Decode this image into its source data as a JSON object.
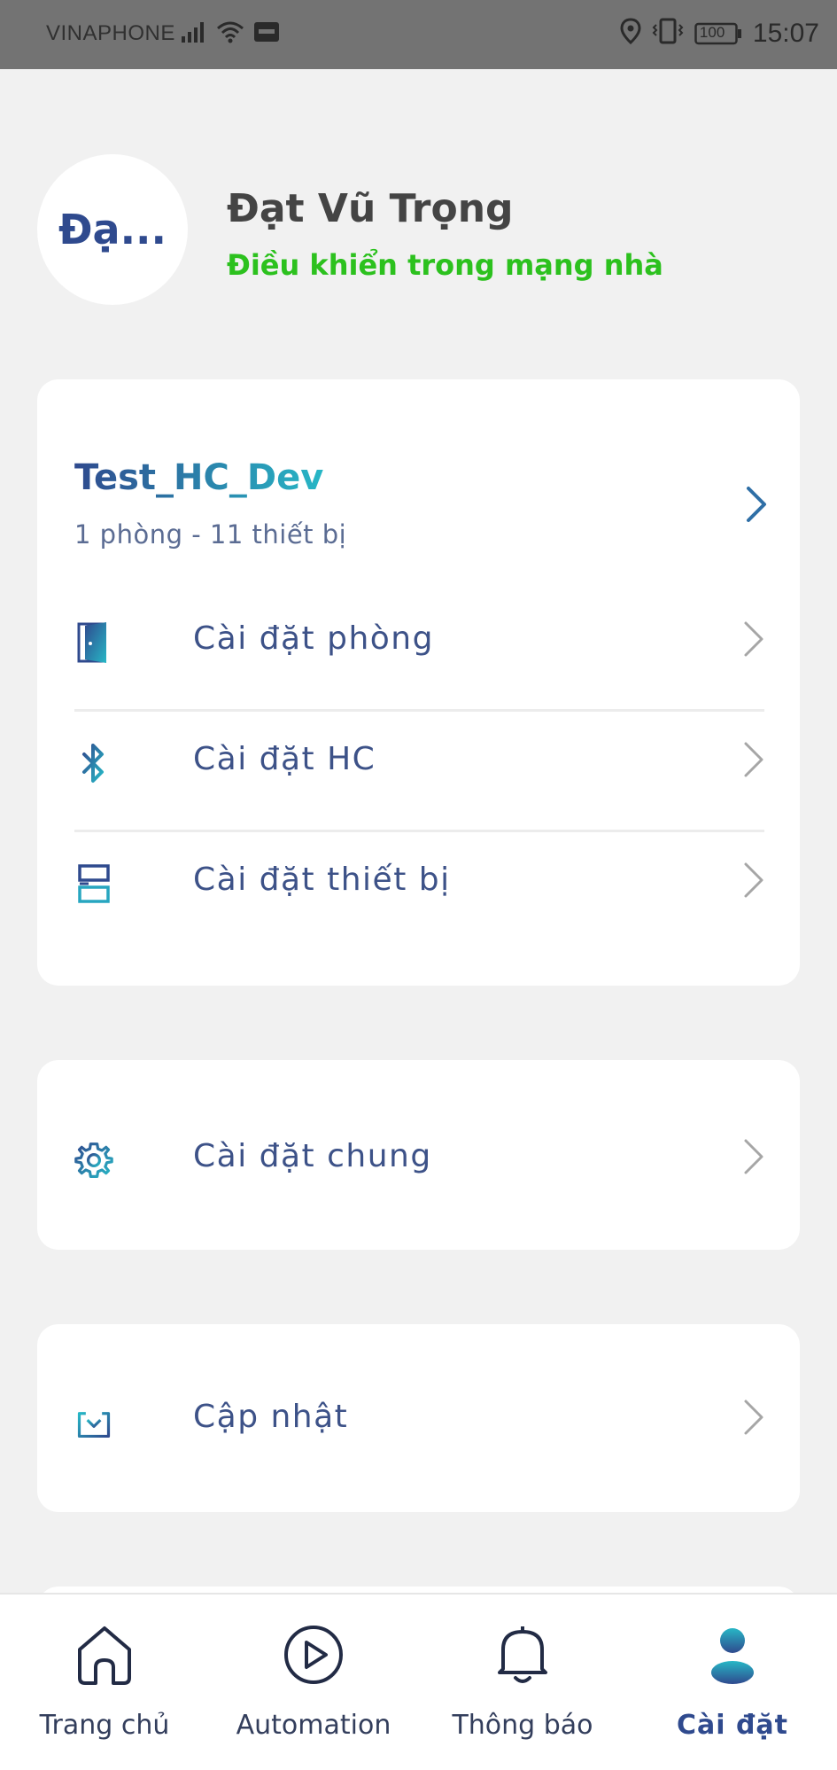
{
  "status_bar": {
    "carrier": "VINAPHONE",
    "battery": "100",
    "time": "15:07"
  },
  "profile": {
    "avatar_text": "Đạ...",
    "name": "Đạt Vũ Trọng",
    "mode": "Điều khiển trong mạng nhà"
  },
  "home": {
    "name": "Test_HC_Dev",
    "summary": "1 phòng - 11 thiết bị",
    "items": [
      {
        "label": "Cài đặt phòng",
        "icon": "door-icon"
      },
      {
        "label": "Cài đặt HC",
        "icon": "bluetooth-icon"
      },
      {
        "label": "Cài đặt thiết bị",
        "icon": "device-icon"
      }
    ]
  },
  "general": {
    "label": "Cài đặt chung",
    "icon": "gear-icon"
  },
  "update": {
    "label": "Cập nhật",
    "icon": "download-icon"
  },
  "nav": [
    {
      "label": "Trang chủ",
      "icon": "home-icon",
      "active": false
    },
    {
      "label": "Automation",
      "icon": "play-icon",
      "active": false
    },
    {
      "label": "Thông báo",
      "icon": "bell-icon",
      "active": false
    },
    {
      "label": "Cài đặt",
      "icon": "user-icon",
      "active": true
    }
  ],
  "colors": {
    "accent_dark": "#2f4a8e",
    "accent_teal": "#27b7c6",
    "status_green": "#2cc11e",
    "background": "#f1f1f1"
  }
}
